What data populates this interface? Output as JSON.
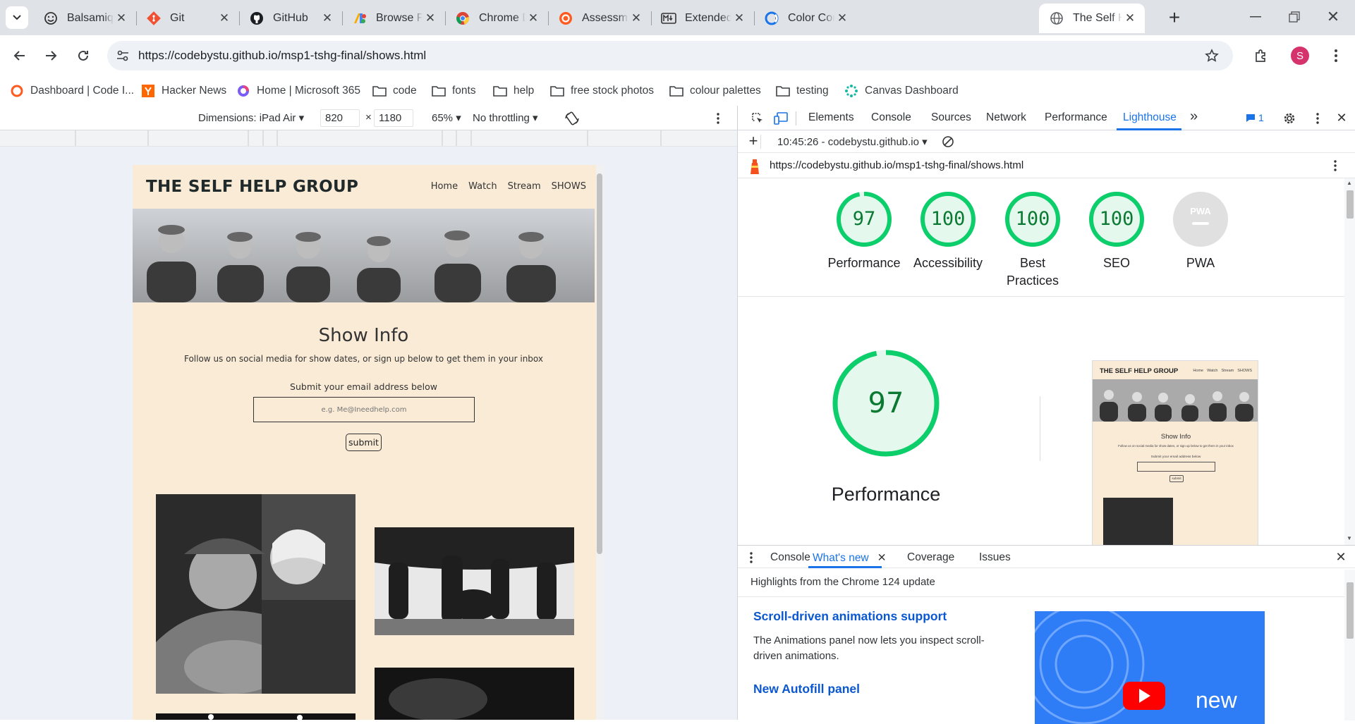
{
  "tabs": [
    {
      "title": "Balsamiq: Fas",
      "icon": "smiley-icon"
    },
    {
      "title": "Git",
      "icon": "git-icon"
    },
    {
      "title": "GitHub",
      "icon": "github-icon"
    },
    {
      "title": "Browse Fonts",
      "icon": "google-fonts-icon"
    },
    {
      "title": "Chrome DevT",
      "icon": "chrome-icon"
    },
    {
      "title": "Assessment C",
      "icon": "assessment-icon"
    },
    {
      "title": "Extended Syn",
      "icon": "markdown-icon"
    },
    {
      "title": "Color Contrast",
      "icon": "color-contrast-icon"
    },
    {
      "title": "The Self Help",
      "icon": "globe-icon",
      "active": true
    }
  ],
  "browser": {
    "url": "https://codebystu.github.io/msp1-tshg-final/shows.html",
    "profile_initial": "S",
    "accent": "#1a73e8"
  },
  "bookmarks": [
    {
      "label": "Dashboard | Code I...",
      "icon": "code-institute-icon"
    },
    {
      "label": "Hacker News",
      "icon": "hacker-news-icon"
    },
    {
      "label": "Home | Microsoft 365",
      "icon": "microsoft-365-icon"
    },
    {
      "label": "code",
      "icon": "folder-icon"
    },
    {
      "label": "fonts",
      "icon": "folder-icon"
    },
    {
      "label": "help",
      "icon": "folder-icon"
    },
    {
      "label": "free stock photos",
      "icon": "folder-icon"
    },
    {
      "label": "colour palettes",
      "icon": "folder-icon"
    },
    {
      "label": "testing",
      "icon": "folder-icon"
    },
    {
      "label": "Canvas Dashboard",
      "icon": "canvas-icon"
    }
  ],
  "device_toolbar": {
    "dimensions": "Dimensions: iPad Air",
    "width": "820",
    "times": "×",
    "height": "1180",
    "zoom": "65%",
    "throttling": "No throttling"
  },
  "site": {
    "title": "THE SELF HELP GROUP",
    "nav": [
      "Home",
      "Watch",
      "Stream",
      "SHOWS"
    ],
    "show_title": "Show Info",
    "show_subtitle": "Follow us on social media for show dates, or sign up below to get them in your inbox",
    "email_label": "Submit your email address below",
    "email_placeholder": "e.g. Me@Ineedhelp.com",
    "submit": "submit",
    "bg_color": "#faebd7"
  },
  "devtools": {
    "tabs": [
      "Elements",
      "Console",
      "Sources",
      "Network",
      "Performance",
      "Lighthouse"
    ],
    "active_tab": "Lighthouse",
    "more": "»",
    "issues_count": "1",
    "report_time": "10:45:26 - codebystu.github.io",
    "report_url": "https://codebystu.github.io/msp1-tshg-final/shows.html"
  },
  "lighthouse": {
    "scores": [
      {
        "label": "Performance",
        "value": 97
      },
      {
        "label": "Accessibility",
        "value": 100
      },
      {
        "label": "Best Practices",
        "value": 100
      },
      {
        "label": "SEO",
        "value": 100
      },
      {
        "label": "PWA",
        "value": null
      }
    ],
    "pwa_badge": "PWA",
    "main_score": "97",
    "main_label": "Performance",
    "pass_color": "#0cce6b"
  },
  "drawer": {
    "tabs": [
      "Console",
      "What's new",
      "Coverage",
      "Issues"
    ],
    "active_tab": "What's new",
    "highlights": "Highlights from the Chrome 124 update",
    "news": [
      {
        "title": "Scroll-driven animations support",
        "body": "The Animations panel now lets you inspect scroll-driven animations."
      },
      {
        "title": "New Autofill panel",
        "body": ""
      }
    ],
    "video_text": "new"
  }
}
